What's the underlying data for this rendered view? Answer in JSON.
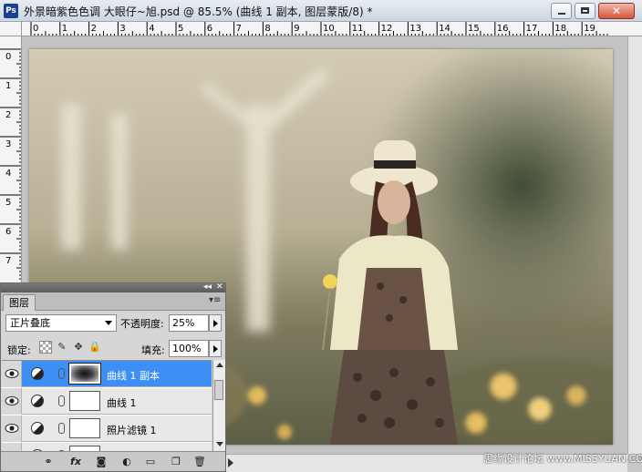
{
  "window": {
    "app_badge": "Ps",
    "title": "外景暗紫色色调 大眼仔~旭.psd @ 85.5% (曲线 1 副本, 图层蒙版/8) *",
    "close_glyph": "✕"
  },
  "rulers": {
    "horizontal_labels": [
      "0",
      "1",
      "2",
      "3",
      "4",
      "5",
      "6",
      "7",
      "8",
      "9",
      "10",
      "11",
      "12",
      "13",
      "14",
      "15",
      "16",
      "17",
      "18",
      "19"
    ],
    "vertical_labels": [
      "0",
      "1",
      "2",
      "3",
      "4",
      "5",
      "6",
      "7"
    ]
  },
  "layers_panel": {
    "tab_label": "图层",
    "collapse_glyph": "◂◂",
    "close_glyph": "✕",
    "menu_glyph": "▾≡",
    "blend_mode": "正片叠底",
    "opacity_label": "不透明度:",
    "opacity_value": "25%",
    "lock_label": "锁定:",
    "lock_image_glyph": "✎",
    "lock_position_glyph": "✥",
    "lock_all_glyph": "🔒",
    "fill_label": "填充:",
    "fill_value": "100%",
    "layers": [
      {
        "name": "曲线 1 副本",
        "selected": true
      },
      {
        "name": "曲线 1",
        "selected": false
      },
      {
        "name": "照片滤镜 1",
        "selected": false
      }
    ],
    "bottom_icons": {
      "link": "⚭",
      "fx": "fx",
      "mask": "◙",
      "adjustment": "◐",
      "group": "▭",
      "new": "❐",
      "delete": "🗑"
    }
  },
  "watermark": "思缘设计论坛 www.MISSYUAN.COM"
}
